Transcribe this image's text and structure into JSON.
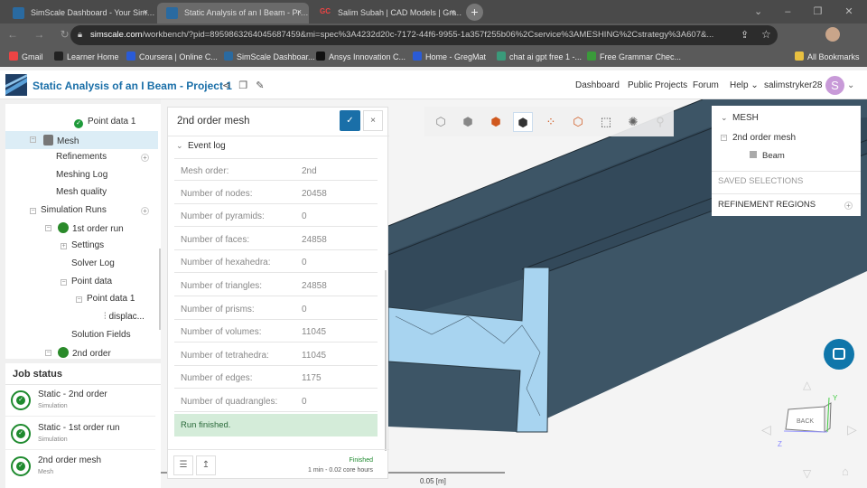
{
  "browser": {
    "tabs": [
      {
        "label": "SimScale Dashboard - Your Sim…",
        "active": false
      },
      {
        "label": "Static Analysis of an I Beam - Pr…",
        "active": true
      },
      {
        "label": "Salim Subah | CAD Models | Gra…",
        "active": false
      }
    ],
    "url_domain": "simscale.com",
    "url_path": "/workbench/?pid=8959863264045687459&mi=spec%3A4232d20c-7172-44f6-9955-1a357f255b06%2Cservice%3AMESHING%2Cstrategy%3A607&...",
    "bookmarks": [
      "Gmail",
      "Learner Home",
      "Coursera | Online C...",
      "SimScale Dashboar...",
      "Ansys Innovation C...",
      "Home - GregMat",
      "chat ai gpt free 1 -...",
      "Free Grammar Chec..."
    ],
    "all_bookmarks": "All Bookmarks"
  },
  "app": {
    "title": "Static Analysis of an I Beam - Project 1",
    "nav": [
      "Dashboard",
      "Public Projects",
      "Forum",
      "Help ⌄"
    ],
    "user": "salimstryker28",
    "avatar": "S"
  },
  "tree": {
    "items": [
      "Point data 1",
      "Mesh",
      "Refinements",
      "Meshing Log",
      "Mesh quality",
      "Simulation Runs",
      "1st order run",
      "Settings",
      "Solver Log",
      "Point data",
      "Point data 1",
      "displac...",
      "Solution Fields",
      "2nd order"
    ]
  },
  "jobs": {
    "title": "Job status",
    "items": [
      {
        "name": "Static - 2nd order",
        "type": "Simulation"
      },
      {
        "name": "Static - 1st order run",
        "type": "Simulation"
      },
      {
        "name": "2nd order mesh",
        "type": "Mesh"
      }
    ]
  },
  "dialog": {
    "title": "2nd order mesh",
    "section": "Event log",
    "rows": [
      [
        "Mesh order:",
        "2nd"
      ],
      [
        "Number of nodes:",
        "20458"
      ],
      [
        "Number of pyramids:",
        "0"
      ],
      [
        "Number of faces:",
        "24858"
      ],
      [
        "Number of hexahedra:",
        "0"
      ],
      [
        "Number of triangles:",
        "24858"
      ],
      [
        "Number of prisms:",
        "0"
      ],
      [
        "Number of volumes:",
        "11045"
      ],
      [
        "Number of tetrahedra:",
        "11045"
      ],
      [
        "Number of edges:",
        "1175"
      ],
      [
        "Number of quadrangles:",
        "0"
      ]
    ],
    "message": "Run finished.",
    "status": "Finished",
    "duration": "1 min - 0.02 core hours"
  },
  "meshpanel": {
    "title": "MESH",
    "mesh": "2nd order mesh",
    "part": "Beam",
    "saved": "SAVED SELECTIONS",
    "refinement": "REFINEMENT REGIONS"
  },
  "viewport": {
    "scale": "0.05 [m]",
    "cube_face": "BACK",
    "axes": [
      "Y",
      "Z"
    ]
  },
  "colors": {
    "accent": "#1a6fa8",
    "success": "#1e8a2e",
    "beam": "#3d5566",
    "section": "#a8d4f0"
  }
}
